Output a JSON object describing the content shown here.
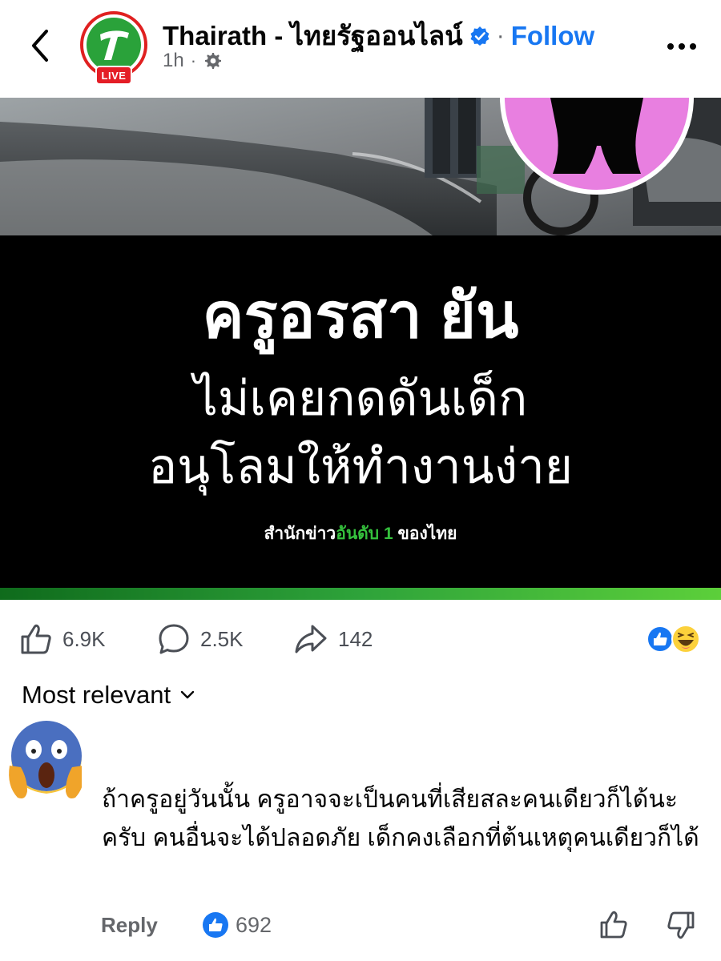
{
  "header": {
    "page_name": "Thairath - ไทยรัฐออนไลน์",
    "separator": "·",
    "follow_label": "Follow",
    "time": "1h",
    "meta_separator": "·",
    "live_badge": "LIVE",
    "icons": [
      "back-chevron-icon",
      "verified-badge-icon",
      "gear-icon",
      "more-dots-icon"
    ]
  },
  "post_image": {
    "headline_1": "ครูอรสา ยัน",
    "headline_2": "ไม่เคยกดดันเด็ก",
    "headline_3": "อนุโลมให้ทำงานง่าย",
    "tagline_white_1": "สำนักข่าว",
    "tagline_green": "อันดับ 1",
    "tagline_white_2": " ของไทย"
  },
  "actions": {
    "likes": "6.9K",
    "comments": "2.5K",
    "shares": "142",
    "reaction_icons": [
      "like-reaction-icon",
      "haha-reaction-icon"
    ]
  },
  "sort": {
    "label": "Most relevant"
  },
  "comment": {
    "avatar_icon": "screaming-face-emoji-icon",
    "text": "ถ้าครูอยู่วันนั้น ครูอาจจะเป็นคนที่เสียสละคนเดียวก็ได้นะครับ คนอื่นจะได้ปลอดภัย เด็กคงเลือกที่ต้นเหตุคนเดียวก็ได้",
    "reply_label": "Reply",
    "like_count": "692"
  },
  "colors": {
    "facebook_blue": "#1877f2",
    "live_red": "#e41e26",
    "brand_green": "#2aa23a",
    "secondary_text": "#65676b"
  }
}
